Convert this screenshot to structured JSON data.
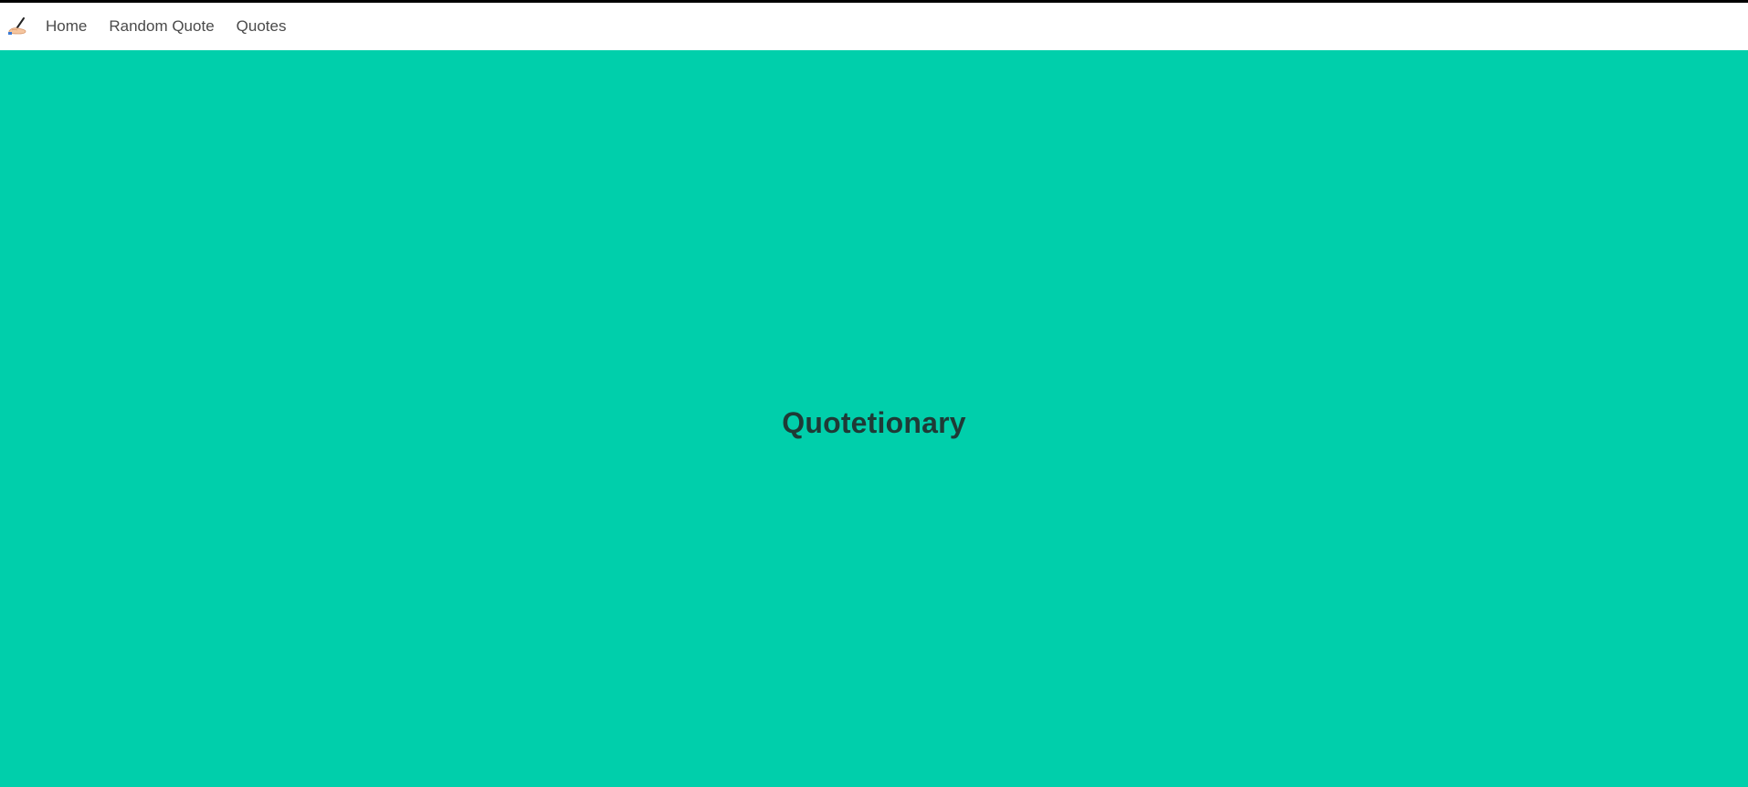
{
  "theme": {
    "hero_background": "#00CFAB",
    "title_color": "#1F3A36",
    "nav_text_color": "#4A4A4A"
  },
  "navbar": {
    "brand_icon": "writing-hand-icon",
    "items": [
      {
        "label": "Home"
      },
      {
        "label": "Random Quote"
      },
      {
        "label": "Quotes"
      }
    ]
  },
  "hero": {
    "title": "Quotetionary"
  }
}
